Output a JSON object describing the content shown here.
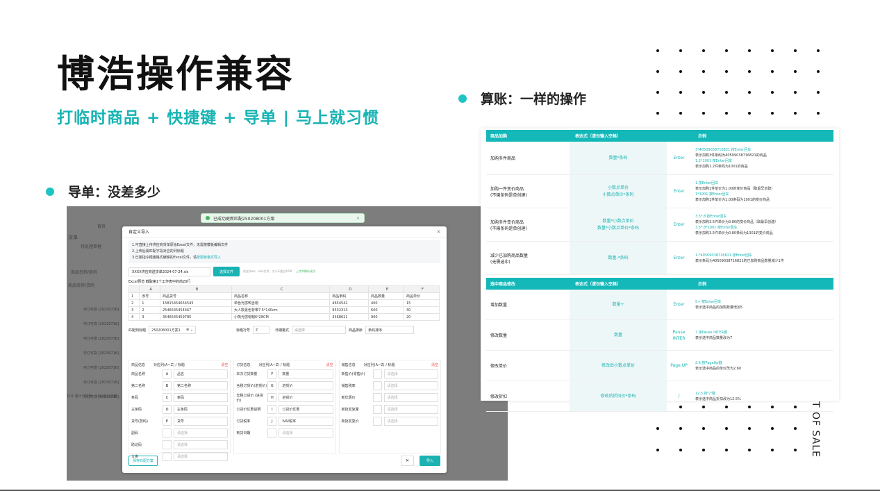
{
  "slide": {
    "title": "博浩操作兼容",
    "subtitle": "打临时商品 + 快捷键 + 导单 | 马上就习惯",
    "bullet_left": "导单：没差多少",
    "bullet_right": "算账：一样的操作",
    "vertical_text": "T OF SALE",
    "colors": {
      "accent": "#17b3b4",
      "bullet": "#1ec3c4",
      "table_header": "#14b8b9"
    }
  },
  "import_screenshot": {
    "toast": "已成功更新匹配250208001方案",
    "bg_labels": [
      "货单",
      "首页",
      "待处理单据",
      "库存量",
      "匹配下单",
      "导入",
      "商品名称/条码",
      "商品名称/货码"
    ],
    "bg_rows": [
      "可订可货 [20230716]",
      "可订可货 [20230716]",
      "可订可货 [20230716]",
      "可订可货 [20230716]",
      "可订可货 [20230716]",
      "可订可货 [20230716]",
      "可订可货 [20230716]"
    ],
    "bg_footer": "共计 累计订货数：100  累计金额",
    "modal_title": "自定义导入",
    "notes": [
      "1.可直接上传供应商货单原始Excel文件，无需按模板编辑文件",
      "2.上传后需匹配字段对应的列标题",
      "3.已按指令模版格式编辑的Excel文件，请"
    ],
    "notes_link": "按模板格式导入",
    "file_name": "XXXX供应商送货单2024-07-24.xls",
    "choose_file": "选择文件",
    "file_hint": "仅支持xls、xlsx文件，大小不超过10M",
    "upload_ok": "上传并解析成功",
    "preview_title": "Excel预览  截取第1个工作表中的前20行",
    "sheet_cols": [
      "",
      "A",
      "B",
      "C",
      "D",
      "E",
      "F"
    ],
    "sheet_rows": [
      [
        "1",
        "序号",
        "商品货号",
        "商品名称",
        "商品条码",
        "商品数量",
        "商品单价"
      ],
      [
        "2",
        "1",
        "15815454654545",
        "单色光感鸭舌帽",
        "4654542",
        "400",
        "15"
      ],
      [
        "3",
        "2",
        "2546545454467",
        "大人款素色背带7.5*140cm",
        "9532313",
        "600",
        "30"
      ],
      [
        "4",
        "3",
        "3546545459785",
        "小熊光感帽帽6*28CM",
        "3468621",
        "900",
        "20"
      ]
    ],
    "match_label": "匹配列标题",
    "match_value": "250208001方案1",
    "header_row_label": "标题行号",
    "header_row_value": "2",
    "date_format_label": "日期格式",
    "date_format_ph": "请选择",
    "sort_label": "商品排序",
    "sort_value": "条码排序",
    "columns": [
      {
        "title": "商品信息",
        "sub": "对应列(A~Z) / 标题",
        "clear": "清空",
        "fields": [
          {
            "label": "商品名称",
            "key": "A",
            "value": "品名"
          },
          {
            "label": "第二名称",
            "key": "B",
            "value": "第二名称"
          },
          {
            "label": "条码",
            "key": "C",
            "value": "条码"
          },
          {
            "label": "主条码",
            "key": "D",
            "value": "主条码"
          },
          {
            "label": "货号(款码)",
            "key": "E",
            "value": "货号"
          },
          {
            "label": "副码",
            "key": "",
            "value": "请选择"
          },
          {
            "label": "助记码",
            "key": "",
            "value": "请选择"
          },
          {
            "label": "分类",
            "key": "",
            "value": "请选择"
          }
        ]
      },
      {
        "title": "订货信息",
        "sub": "对应列(A~Z) / 标题",
        "clear": "清空",
        "fields": [
          {
            "label": "本次订货数量",
            "key": "F",
            "value": "数量"
          },
          {
            "label": "含税订货价(进货价)",
            "key": "G",
            "value": "进货价"
          },
          {
            "label": "去税订货价 (进货价)",
            "key": "H",
            "value": "进货价"
          },
          {
            "label": "订货价优惠说明",
            "key": "I",
            "value": "订货价优惠"
          },
          {
            "label": "订货税率",
            "key": "J",
            "value": "IVA/税率"
          },
          {
            "label": "到货日期",
            "key": "",
            "value": "请选择"
          }
        ]
      },
      {
        "title": "销售信息",
        "sub": "对应列(A~Z) / 标题",
        "clear": "清空",
        "fields": [
          {
            "label": "新售价(零售价)",
            "key": "",
            "value": "请选择"
          },
          {
            "label": "销售税率",
            "key": "",
            "value": "请选择"
          },
          {
            "label": "新优惠价",
            "key": "",
            "value": "请选择"
          },
          {
            "label": "新批发复量",
            "key": "",
            "value": "请选择"
          },
          {
            "label": "新批发复价",
            "key": "",
            "value": "请选择"
          }
        ]
      }
    ],
    "save_plan": "保存匹配方案",
    "close": "✕",
    "import": "导入"
  },
  "shortcut_table": {
    "header1": [
      "商品加购",
      "表达式（请勿输入空格）",
      "示例"
    ],
    "rows1": [
      {
        "name": [
          "加购多件商品"
        ],
        "expr": [
          "数量*条码"
        ],
        "key": "Enter",
        "ex_t": [
          "3*40509038716821 按Enter回车"
        ],
        "ex_d": [
          "表示加购3件条码为40509038716821的商品"
        ],
        "ex_t2": [
          "1.2*1001 按Enter回车"
        ],
        "ex_d2": [
          "表示加购1.2件条码为1001的商品"
        ]
      },
      {
        "name": [
          "加购一件变价商品",
          "(不输条码是单创建)"
        ],
        "expr": [
          "小数点单价",
          "小数点单价*条码"
        ],
        "key": "Enter",
        "ex_t": [
          "1.按Enter回车"
        ],
        "ex_d": [
          "表示加购1件单价为1.00的变价商品（取最早创建）"
        ],
        "ex_t2": [
          "1*1001 按Enter回车"
        ],
        "ex_d2": [
          "表示加购1件单价为1.00条码为1001的变价商品"
        ]
      },
      {
        "name": [
          "加购多件变价商品",
          "(不输条码是单创建)"
        ],
        "expr": [
          "数量*小数点单价",
          "数量*小数点单价*条码"
        ],
        "key": "Enter",
        "ex_t": [
          "3.5*.8 按Enter回车"
        ],
        "ex_d": [
          "表示加购3.5件单价为0.80的变价商品（取最早创建）"
        ],
        "ex_t2": [
          "3.5*.8*1001 按Enter回车"
        ],
        "ex_d2": [
          "表示加购3.5件单价为0.80条码为1001的变价商品"
        ]
      },
      {
        "name": [
          "减少已加购商品数量",
          "(无需选中)"
        ],
        "expr": [
          "数量-*条码"
        ],
        "key": "Enter",
        "ex_t": [
          "1-*40509038716821 按Enter回车"
        ],
        "ex_d": [
          "表示条码为40509038716821的已加购商品数量减少1件"
        ],
        "ex_t2": [],
        "ex_d2": []
      }
    ],
    "header2": [
      "选中商品修改",
      "表达式（请勿输入空格）",
      "示例"
    ],
    "rows2": [
      {
        "name": [
          "增加数量"
        ],
        "expr": [
          "数量+"
        ],
        "key": "Enter",
        "ex_t": [
          "5+ 按Enter回车"
        ],
        "ex_d": [
          "表示选中商品的加购数量增加5"
        ]
      },
      {
        "name": [
          "修改数量"
        ],
        "expr": [
          "数量"
        ],
        "key": "Pause INTER",
        "ex_t": [
          "7 按Pause INTER键"
        ],
        "ex_d": [
          "表示选中商品数量改为7"
        ]
      },
      {
        "name": [
          "修改单价"
        ],
        "expr": [
          "修改后小数点单价"
        ],
        "key": "Page UP",
        "ex_t": [
          "2.6 按PageUp键"
        ],
        "ex_d": [
          "表示选中商品的单价改为2.60"
        ]
      },
      {
        "name": [
          "修改折扣"
        ],
        "expr": [
          "修改后折扣价*条码"
        ],
        "key": "/",
        "ex_t": [
          "12.5 按\"/\"键"
        ],
        "ex_d": [
          "表示选中商品折扣改为12.5%"
        ]
      }
    ]
  }
}
